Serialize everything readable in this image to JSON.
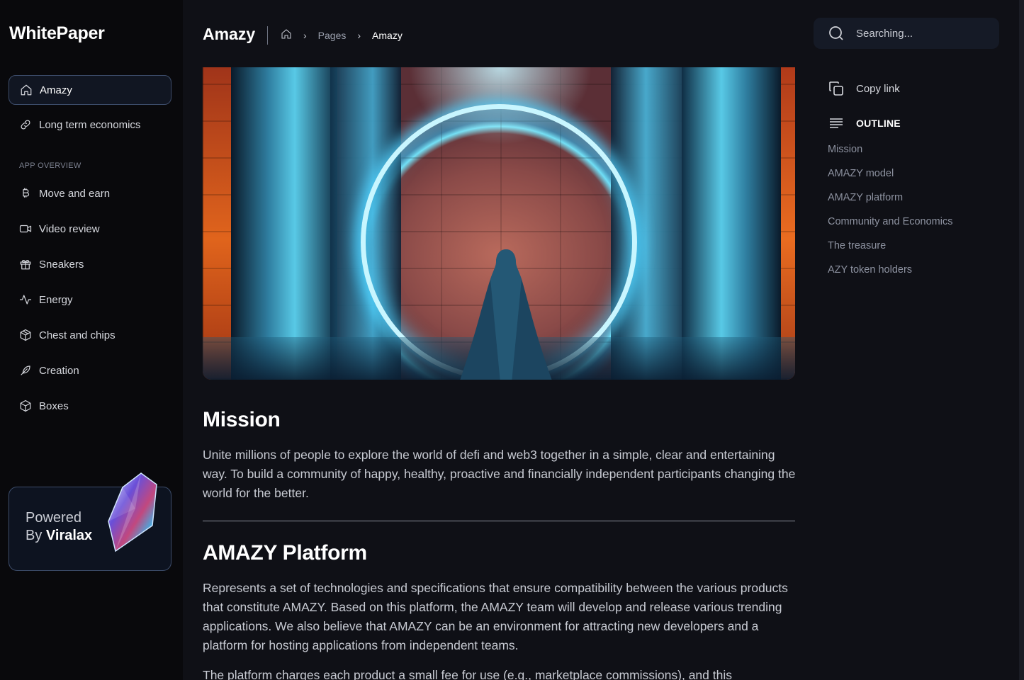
{
  "app": {
    "logo": "WhitePaper"
  },
  "sidebar": {
    "items": [
      {
        "label": "Amazy",
        "icon": "home-icon",
        "active": true
      },
      {
        "label": "Long term economics",
        "icon": "link-icon"
      }
    ],
    "section_label": "APP OVERVIEW",
    "overview_items": [
      {
        "label": "Move and earn",
        "icon": "bitcoin-icon"
      },
      {
        "label": "Video review",
        "icon": "video-icon"
      },
      {
        "label": "Sneakers",
        "icon": "gift-icon"
      },
      {
        "label": "Energy",
        "icon": "activity-icon"
      },
      {
        "label": "Chest and chips",
        "icon": "package-icon"
      },
      {
        "label": "Creation",
        "icon": "feather-icon"
      },
      {
        "label": "Boxes",
        "icon": "box-icon"
      }
    ],
    "powered": {
      "line1": "Powered",
      "line2_prefix": "By ",
      "line2_brand": "Viralax"
    }
  },
  "header": {
    "title": "Amazy",
    "breadcrumb": {
      "pages": "Pages",
      "current": "Amazy"
    }
  },
  "main": {
    "sections": [
      {
        "heading": "Mission",
        "paragraph": "Unite millions of people to explore the world of defi and web3 together in a simple, clear and entertaining way. To build a community of happy, healthy, proactive and financially independent participants changing the world for the better."
      },
      {
        "heading": "AMAZY Platform",
        "paragraph": "Represents a set of technologies and specifications that ensure compatibility between the various products that constitute AMAZY. Based on this platform, the AMAZY team will develop and release various trending applications. We also believe that AMAZY can be an environment for attracting new developers and a platform for hosting applications from independent teams.",
        "paragraph2": "The platform charges each product a small fee for use (e.g., marketplace commissions), and this"
      }
    ]
  },
  "right": {
    "search_placeholder": "Searching...",
    "copy_link": "Copy link",
    "outline_label": "OUTLINE",
    "toc": [
      "Mission",
      "AMAZY model",
      "AMAZY platform",
      "Community and Economics",
      "The treasure",
      "AZY token holders"
    ]
  }
}
